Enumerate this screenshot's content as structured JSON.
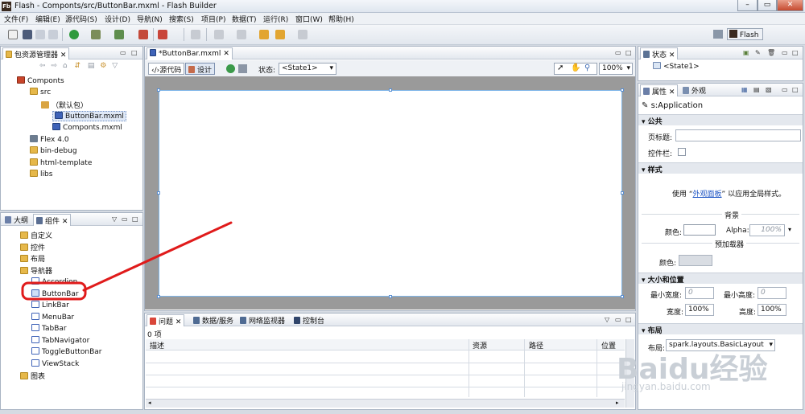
{
  "window": {
    "title": "Flash  - Componts/src/ButtonBar.mxml - Flash Builder",
    "app_icon": "Fb"
  },
  "menu": [
    "文件(F)",
    "编辑(E)",
    "源代码(S)",
    "设计(D)",
    "导航(N)",
    "搜索(S)",
    "项目(P)",
    "数据(T)",
    "运行(R)",
    "窗口(W)",
    "帮助(H)"
  ],
  "perspective": {
    "label": "Flash"
  },
  "package_explorer": {
    "tab": "包资源管理器",
    "tree": [
      {
        "label": "Componts",
        "icon": "project-icon"
      },
      {
        "label": "src",
        "icon": "folder-icon"
      },
      {
        "label": "（默认包）",
        "icon": "package-icon"
      },
      {
        "label": "ButtonBar.mxml",
        "icon": "mxml-file-icon"
      },
      {
        "label": "Componts.mxml",
        "icon": "mxml-file-icon"
      },
      {
        "label": "Flex 4.0",
        "icon": "library-icon"
      },
      {
        "label": "bin-debug",
        "icon": "folder-icon"
      },
      {
        "label": "html-template",
        "icon": "folder-icon"
      },
      {
        "label": "libs",
        "icon": "folder-icon"
      }
    ]
  },
  "components_panel": {
    "tab_outline": "大纲",
    "tab_components": "组件",
    "tree": [
      {
        "label": "自定义",
        "icon": "folder-icon"
      },
      {
        "label": "控件",
        "icon": "folder-icon"
      },
      {
        "label": "布局",
        "icon": "folder-icon"
      },
      {
        "label": "导航器",
        "icon": "folder-icon"
      },
      {
        "label": "Accordion",
        "icon": "accordion-icon"
      },
      {
        "label": "ButtonBar",
        "icon": "buttonbar-icon"
      },
      {
        "label": "LinkBar",
        "icon": "linkbar-icon"
      },
      {
        "label": "MenuBar",
        "icon": "menubar-icon"
      },
      {
        "label": "TabBar",
        "icon": "tabbar-icon"
      },
      {
        "label": "TabNavigator",
        "icon": "tabnavigator-icon"
      },
      {
        "label": "ToggleButtonBar",
        "icon": "togglebuttonbar-icon"
      },
      {
        "label": "ViewStack",
        "icon": "viewstack-icon"
      },
      {
        "label": "图表",
        "icon": "folder-icon"
      }
    ]
  },
  "editor": {
    "tab": "*ButtonBar.mxml",
    "source_btn": "源代码",
    "design_btn": "设计",
    "state_label": "状态:",
    "state_value": "<State1>",
    "zoom": "100%"
  },
  "problems": {
    "tabs": [
      "问题",
      "数据/服务",
      "网络监视器",
      "控制台"
    ],
    "count": "0 项",
    "columns": [
      "描述",
      "资源",
      "路径",
      "位置"
    ]
  },
  "states_panel": {
    "tab": "状态",
    "item": "<State1>"
  },
  "properties_panel": {
    "tab_props": "属性",
    "tab_appearance": "外观",
    "component": "s:Application",
    "sec_common": "公共",
    "page_title_label": "页标题:",
    "controlbar_label": "控件栏:",
    "sec_style": "样式",
    "style_note_pre": "使用 “",
    "style_link": "外观面板",
    "style_note_post": "” 以应用全局样式。",
    "bg_heading": "背景",
    "color_label": "颜色:",
    "alpha_label": "Alpha:",
    "alpha_value": "100%",
    "preloader_heading": "预加载器",
    "preloader_color_label": "颜色:",
    "sec_size": "大小和位置",
    "min_width_label": "最小宽度:",
    "min_width_value": "0",
    "min_height_label": "最小高度:",
    "min_height_value": "0",
    "width_label": "宽度:",
    "width_value": "100%",
    "height_label": "高度:",
    "height_value": "100%",
    "sec_layout": "布局",
    "layout_label": "布局:",
    "layout_value": "spark.layouts.BasicLayout"
  },
  "watermark": {
    "text": "Baidu经验",
    "url": "jingyan.baidu.com"
  },
  "colors": {
    "annotation_red": "#e01b1b",
    "accent_blue": "#3f63b8"
  }
}
